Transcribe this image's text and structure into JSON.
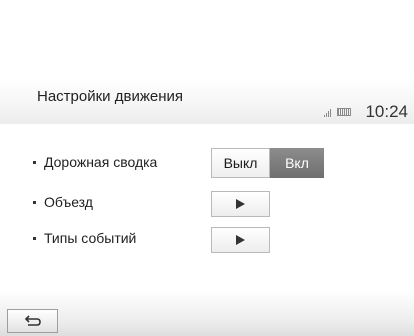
{
  "header": {
    "title": "Настройки движения",
    "time": "10:24",
    "signal_icon": "signal-strength-icon",
    "battery_icon": "battery-icon"
  },
  "settings": {
    "traffic_summary": {
      "label": "Дорожная сводка",
      "off_label": "Выкл",
      "on_label": "Вкл",
      "selected": "Вкл"
    },
    "detour": {
      "label": "Объезд",
      "icon": "play-arrow-icon"
    },
    "event_types": {
      "label": "Типы событий",
      "icon": "play-arrow-icon"
    }
  },
  "footer": {
    "back_icon": "back-return-icon"
  },
  "colors": {
    "toggle_on_bg": "#7d7d7d",
    "toggle_off_bg": "#ffffff",
    "text": "#1a1a1a"
  }
}
